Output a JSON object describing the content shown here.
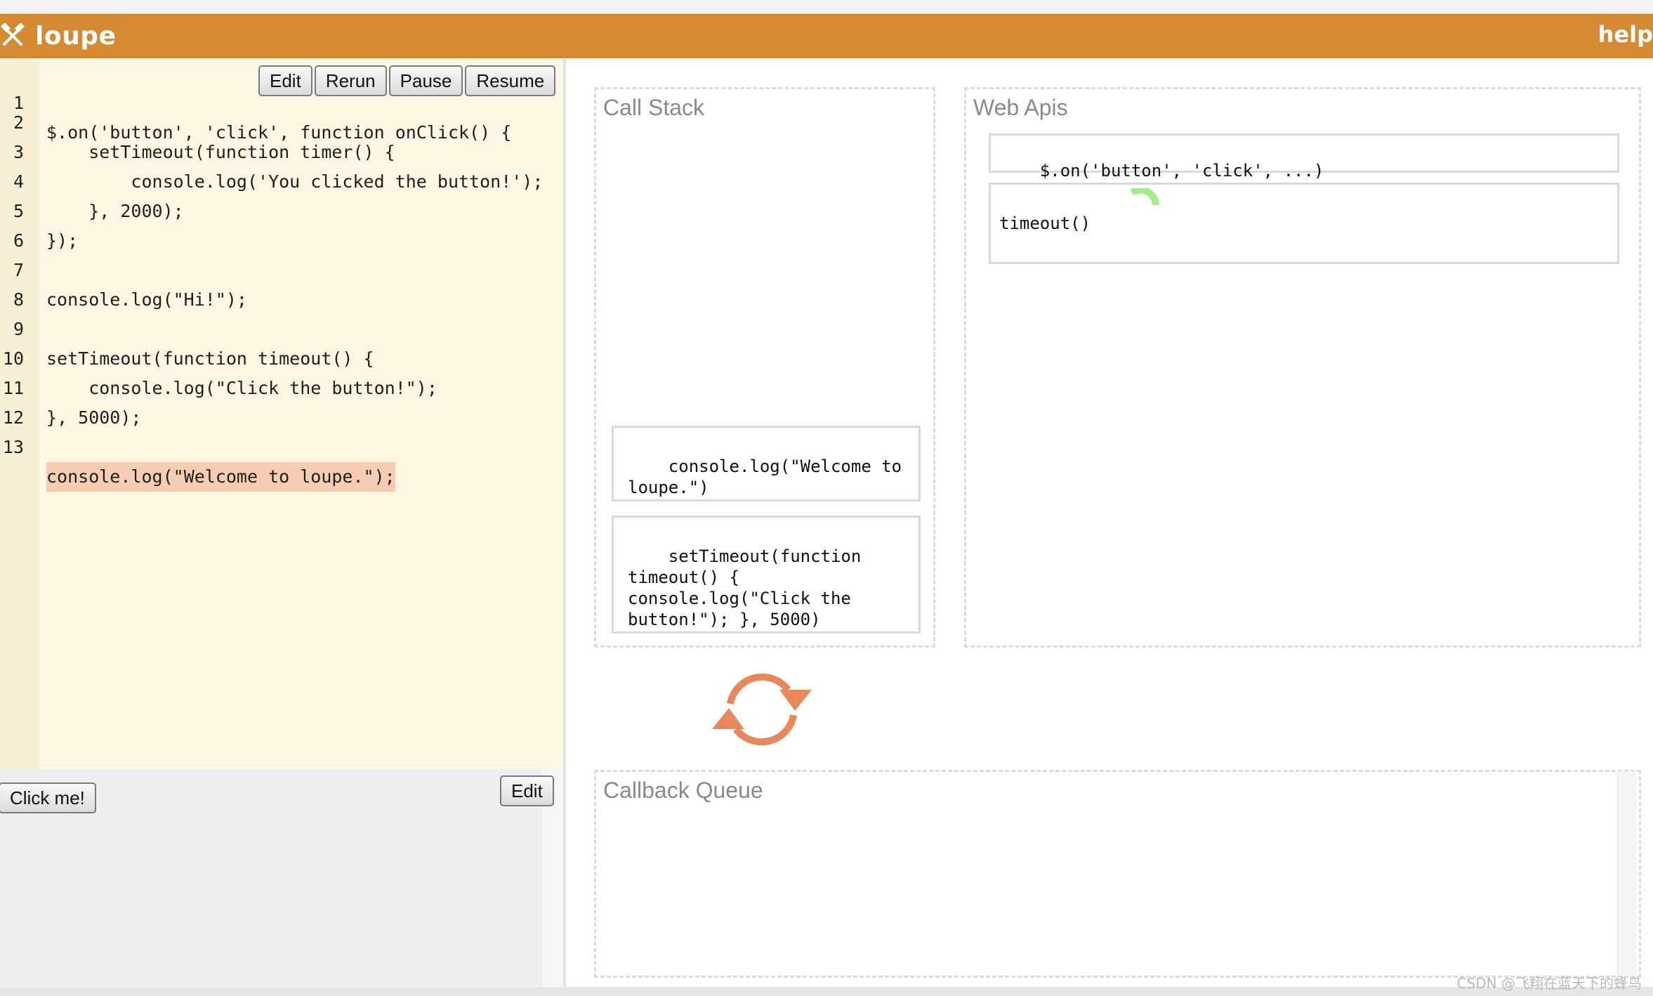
{
  "app": {
    "title": "loupe",
    "help_label": "help",
    "accent_color": "#d38a33"
  },
  "editor": {
    "lines": [
      {
        "num": "1",
        "code": "$.on('button', 'click', function onClick() {"
      },
      {
        "num": "2",
        "code": "    setTimeout(function timer() {"
      },
      {
        "num": "3",
        "code": "        console.log('You clicked the button!');"
      },
      {
        "num": "4",
        "code": "    }, 2000);"
      },
      {
        "num": "5",
        "code": "});"
      },
      {
        "num": "6",
        "code": ""
      },
      {
        "num": "7",
        "code": "console.log(\"Hi!\");"
      },
      {
        "num": "8",
        "code": ""
      },
      {
        "num": "9",
        "code": "setTimeout(function timeout() {"
      },
      {
        "num": "10",
        "code": "    console.log(\"Click the button!\");"
      },
      {
        "num": "11",
        "code": "}, 5000);"
      },
      {
        "num": "12",
        "code": ""
      },
      {
        "num": "13",
        "code": "console.log(\"Welcome to loupe.\");"
      }
    ],
    "highlighted_line": "13",
    "toolbar": {
      "edit": "Edit",
      "rerun": "Rerun",
      "pause": "Pause",
      "resume": "Resume"
    }
  },
  "preview": {
    "click_button": "Click me!",
    "edit_button": "Edit"
  },
  "call_stack": {
    "title": "Call Stack",
    "frames": [
      "console.log(\"Welcome to loupe.\")",
      "setTimeout(function timeout() { console.log(\"Click the button!\"); }, 5000)"
    ]
  },
  "web_apis": {
    "title": "Web Apis",
    "items": [
      "$.on('button', 'click', ...)",
      "timeout()"
    ]
  },
  "callback_queue": {
    "title": "Callback Queue"
  },
  "watermark": "CSDN @飞翔在蓝天下的蜂鸟"
}
